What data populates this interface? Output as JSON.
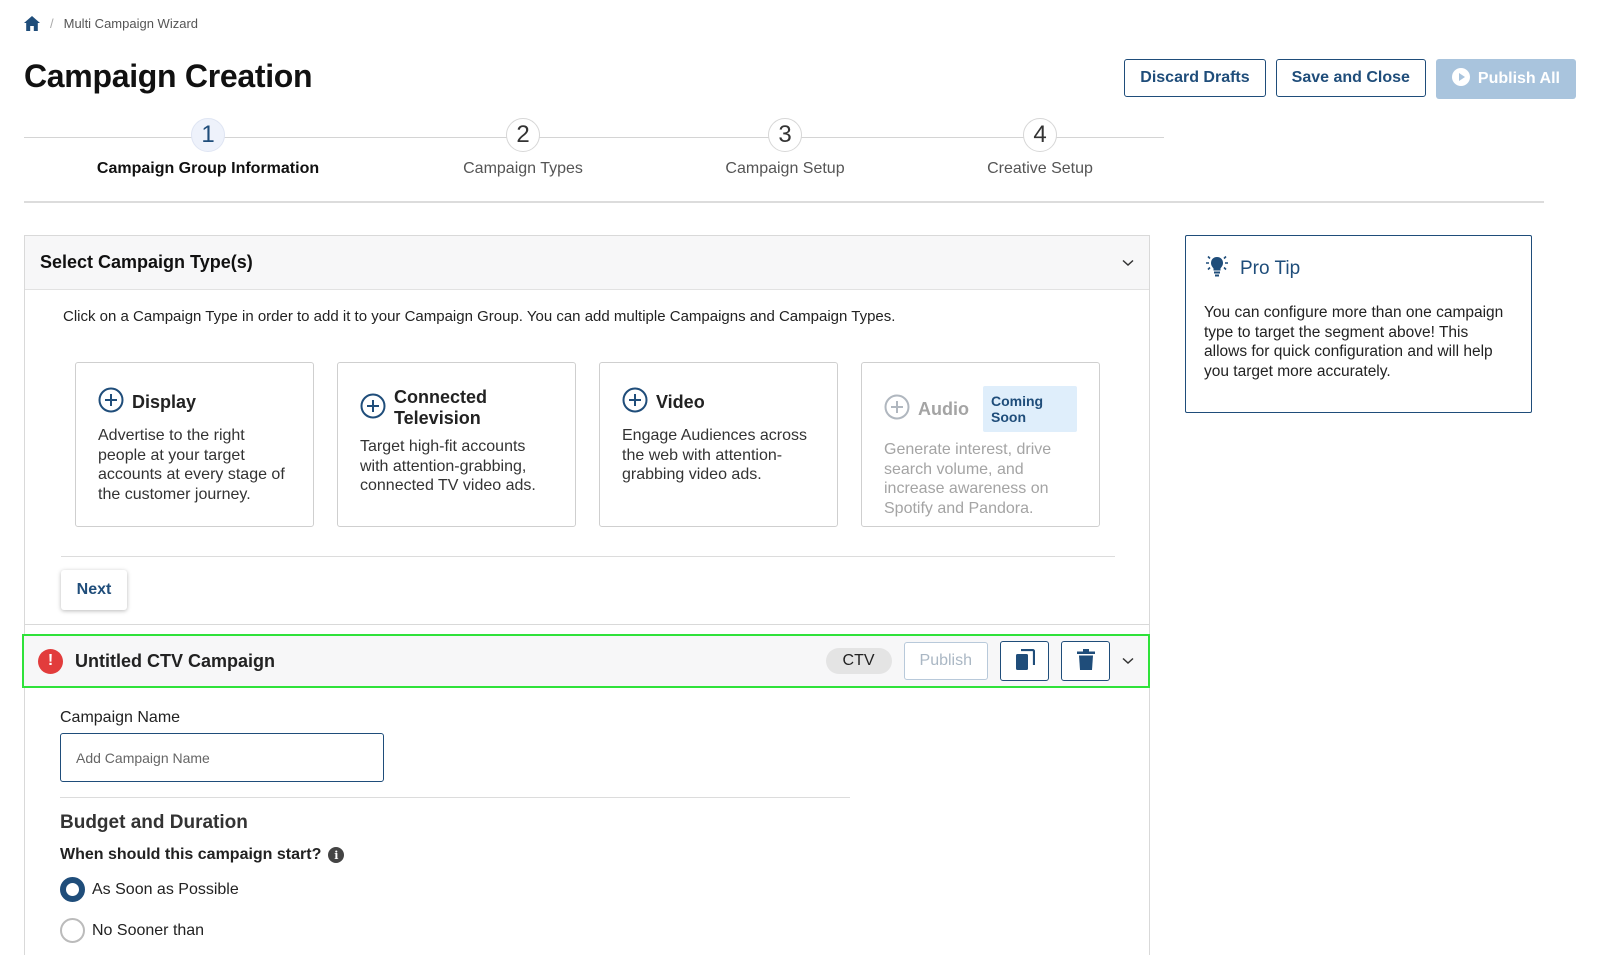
{
  "breadcrumb": {
    "current": "Multi Campaign Wizard"
  },
  "page": {
    "title": "Campaign Creation"
  },
  "actions": {
    "discard_label": "Discard Drafts",
    "save_label": "Save and Close",
    "publish_all_label": "Publish All"
  },
  "stepper": {
    "active_step": 1,
    "steps": [
      {
        "number": "1",
        "label": "Campaign Group Information"
      },
      {
        "number": "2",
        "label": "Campaign Types"
      },
      {
        "number": "3",
        "label": "Campaign Setup"
      },
      {
        "number": "4",
        "label": "Creative Setup"
      }
    ]
  },
  "select_types": {
    "title": "Select Campaign Type(s)",
    "instructions": "Click on a Campaign Type in order to add it to your Campaign Group. You can add multiple Campaigns and Campaign Types.",
    "cards": [
      {
        "title": "Display",
        "description": "Advertise to the right people at your target accounts at every stage of the customer journey."
      },
      {
        "title": "Connected Television",
        "description": "Target high-fit accounts with attention-grabbing, connected TV video ads."
      },
      {
        "title": "Video",
        "description": "Engage Audiences across the web with attention-grabbing video ads."
      },
      {
        "title": "Audio",
        "badge": "Coming Soon",
        "description": "Generate interest, drive search volume, and increase awareness on Spotify and Pandora."
      }
    ],
    "next_label": "Next"
  },
  "campaign": {
    "title": "Untitled CTV Campaign",
    "alert_symbol": "!",
    "type_badge": "CTV",
    "publish_label": "Publish",
    "name_label": "Campaign Name",
    "name_value": "",
    "name_placeholder": "Add Campaign Name",
    "budget_title": "Budget and Duration",
    "start_question": "When should this campaign start?",
    "info_symbol": "i",
    "start_options": [
      {
        "label": "As Soon as Possible",
        "selected": true
      },
      {
        "label": "No Sooner than",
        "selected": false
      }
    ]
  },
  "pro_tip": {
    "title": "Pro Tip",
    "body": "You can configure more than one campaign type to target the segment above! This allows for quick configuration and will help you target more accurately."
  },
  "colors": {
    "brand": "#1f4d7a",
    "highlight": "#2fe23a",
    "alert": "#e23c3c",
    "disabled_button": "#a9c4dd"
  },
  "icons": {
    "home": "home-icon",
    "add": "plus-circle-icon",
    "copy": "copy-icon",
    "delete": "trash-icon",
    "expand": "chevron-down-icon",
    "tip": "lightbulb-icon",
    "play": "play-circle-icon"
  }
}
